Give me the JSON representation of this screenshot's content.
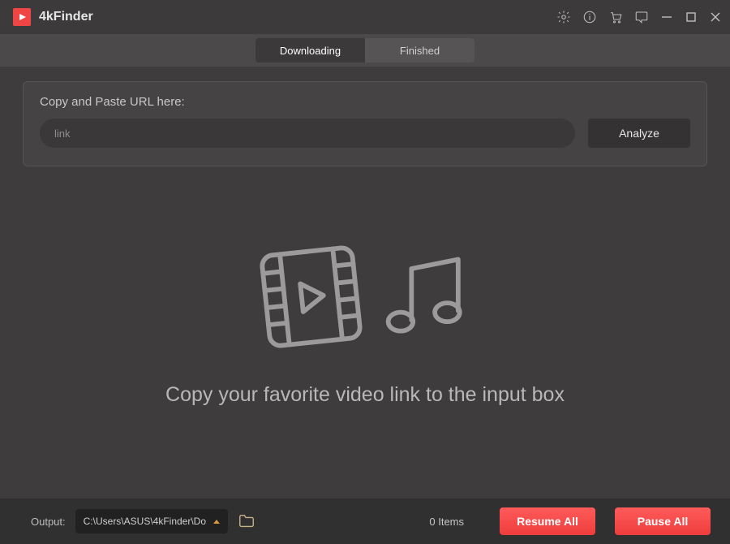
{
  "app": {
    "title": "4kFinder"
  },
  "titlebar_icons": {
    "settings": "gear-icon",
    "info": "info-icon",
    "cart": "cart-icon",
    "chat": "chat-icon",
    "minimize": "minimize-icon",
    "maximize": "maximize-icon",
    "close": "close-icon"
  },
  "tabs": {
    "downloading": "Downloading",
    "finished": "Finished",
    "active": "downloading"
  },
  "url_panel": {
    "label": "Copy and Paste URL here:",
    "input_value": "link",
    "analyze_label": "Analyze"
  },
  "empty_state": {
    "message": "Copy your favorite video link to the input box"
  },
  "bottom": {
    "output_label": "Output:",
    "output_path": "C:\\Users\\ASUS\\4kFinder\\Do",
    "item_count": "0 Items",
    "resume_label": "Resume All",
    "pause_label": "Pause All"
  },
  "colors": {
    "accent_red": "#f04545",
    "button_red": "#ff5b5b"
  }
}
